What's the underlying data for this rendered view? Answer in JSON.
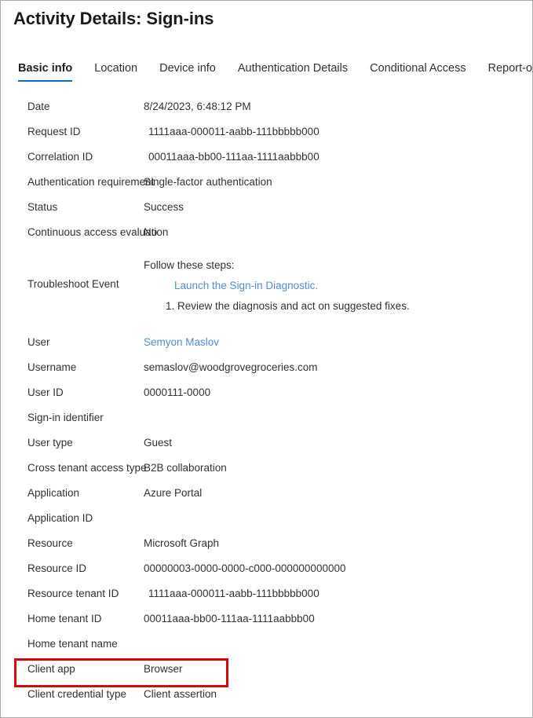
{
  "header": {
    "title": "Activity Details: Sign-ins"
  },
  "tabs": [
    {
      "label": "Basic info",
      "active": true
    },
    {
      "label": "Location",
      "active": false
    },
    {
      "label": "Device info",
      "active": false
    },
    {
      "label": "Authentication Details",
      "active": false
    },
    {
      "label": "Conditional Access",
      "active": false
    },
    {
      "label": "Report-only",
      "active": false
    }
  ],
  "details": {
    "rows_top": [
      {
        "label": "Date",
        "value": "8/24/2023, 6:48:12 PM",
        "indent": false
      },
      {
        "label": "Request ID",
        "value": "1111aaa-000011-aabb-111bbbbb000",
        "indent": true
      },
      {
        "label": "Correlation ID",
        "value": "00011aaa-bb00-111aa-1111aabbb00",
        "indent": true
      },
      {
        "label": "Authentication requirement",
        "value": "Single-factor authentication",
        "indent": false
      },
      {
        "label": "Status",
        "value": "Success",
        "indent": false
      },
      {
        "label": "Continuous access evaluation",
        "value": "No",
        "indent": false
      }
    ],
    "troubleshoot": {
      "label": "Troubleshoot Event",
      "step_head": "Follow these steps:",
      "link": "Launch the Sign-in Diagnostic.",
      "step_one": "1. Review the diagnosis and act on suggested fixes."
    },
    "rows_bottom": [
      {
        "label": "User",
        "value": "Semyon Maslov",
        "link": true,
        "indent": false
      },
      {
        "label": "Username",
        "value": "semaslov@woodgrovegroceries.com",
        "link": false,
        "indent": false
      },
      {
        "label": "User ID",
        "value": "0000111-0000",
        "link": false,
        "indent": false
      },
      {
        "label": "Sign-in identifier",
        "value": "",
        "link": false,
        "indent": false
      },
      {
        "label": "User type",
        "value": "Guest",
        "link": false,
        "indent": false
      },
      {
        "label": "Cross tenant access type",
        "value": "B2B collaboration",
        "link": false,
        "indent": false
      },
      {
        "label": "Application",
        "value": "Azure Portal",
        "link": false,
        "indent": false
      },
      {
        "label": "Application ID",
        "value": "",
        "link": false,
        "indent": false
      },
      {
        "label": "Resource",
        "value": "Microsoft Graph",
        "link": false,
        "indent": false
      },
      {
        "label": "Resource ID",
        "value": "00000003-0000-0000-c000-000000000000",
        "link": false,
        "indent": false
      },
      {
        "label": "Resource tenant ID",
        "value": "1111aaa-000011-aabb-111bbbbb000",
        "link": false,
        "indent": true,
        "copy_ghost": "ı"
      },
      {
        "label": "Home tenant ID",
        "value": "00011aaa-bb00-111aa-1111aabbb00",
        "link": false,
        "indent": false,
        "copy_ghost": "’"
      },
      {
        "label": "Home tenant name",
        "value": "",
        "link": false,
        "indent": false
      },
      {
        "label": "Client app",
        "value": "Browser",
        "link": false,
        "indent": false,
        "highlighted": true
      },
      {
        "label": "Client credential type",
        "value": "Client assertion",
        "link": false,
        "indent": false
      }
    ]
  },
  "colors": {
    "accent": "#0f6cbd",
    "link": "#4f8ed4",
    "highlight_box": "#d20a0a",
    "text": "#323130",
    "frame_border": "#a9a9a9"
  }
}
